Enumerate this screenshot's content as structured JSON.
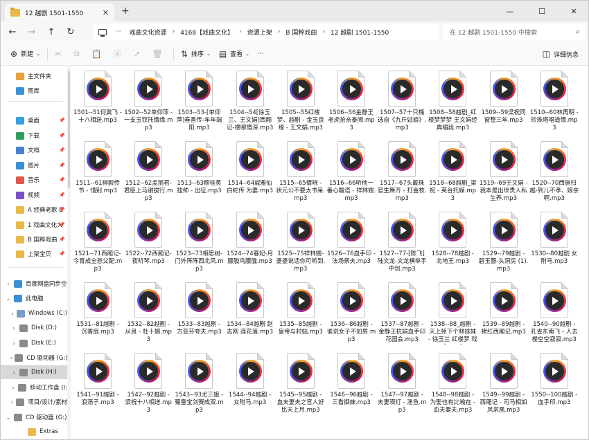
{
  "window": {
    "tab_title": "12 越剧 1501-1550",
    "tab_close": "✕",
    "new_tab": "+",
    "minimize": "—",
    "maximize": "☐",
    "close": "✕"
  },
  "nav": {
    "back": "←",
    "forward": "→",
    "up": "↑",
    "refresh": "↻",
    "more": "···",
    "breadcrumb": [
      "戏曲文化资源",
      "4168【戏曲文化】",
      "资源上架",
      "B 国粹戏曲",
      "12 越剧 1501-1550"
    ],
    "separator": "›",
    "search_placeholder": "在 12 越剧 1501-1550 中搜索",
    "search_icon": "⌕"
  },
  "commands": {
    "new": "新建",
    "new_icon": "⊕",
    "cut_icon": "✂",
    "copy_icon": "⧉",
    "paste_icon": "📋",
    "rename_icon": "Ⓐ",
    "share_icon": "↗",
    "delete_icon": "🗑",
    "sort": "排序",
    "sort_icon": "⇅",
    "view": "查看",
    "view_icon": "▤",
    "more": "···",
    "details": "详细信息",
    "details_icon": "◫"
  },
  "sidebar": {
    "items": [
      {
        "label": "主文件夹",
        "icon": "home-icon",
        "color": "#e9a23b"
      },
      {
        "label": "图库",
        "icon": "gallery-icon",
        "color": "#3a8fd6"
      },
      {
        "label": "桌面",
        "icon": "desktop-icon",
        "color": "#3a9ee0",
        "pin": "📌"
      },
      {
        "label": "下载",
        "icon": "download-icon",
        "color": "#2f9e5a",
        "pin": "📌"
      },
      {
        "label": "文档",
        "icon": "document-icon",
        "color": "#4a7fd4",
        "pin": "📌"
      },
      {
        "label": "图片",
        "icon": "pictures-icon",
        "color": "#3a8fd6",
        "pin": "📌"
      },
      {
        "label": "音乐",
        "icon": "music-icon",
        "color": "#e0584c",
        "pin": "📌"
      },
      {
        "label": "视频",
        "icon": "video-icon",
        "color": "#7b4fc9",
        "pin": "📌"
      },
      {
        "label": "A 经典老歌 E",
        "icon": "folder-icon",
        "color": "#e9b949",
        "pin": "📌"
      },
      {
        "label": "1 戏曲文化大",
        "icon": "folder-icon",
        "color": "#e9b949",
        "pin": "📌"
      },
      {
        "label": "B 国粹戏曲",
        "icon": "folder-icon",
        "color": "#e9b949",
        "pin": "📌"
      },
      {
        "label": "上架宝贝",
        "icon": "folder-icon",
        "color": "#e9b949",
        "pin": "📌"
      },
      {
        "label": "百度网盘同步空",
        "icon": "cloud-icon",
        "color": "#3a8fd6",
        "chev": "›"
      },
      {
        "label": "此电脑",
        "icon": "pc-icon",
        "color": "#3a8fd6",
        "chev": "⌄"
      },
      {
        "label": "Windows (C:)",
        "icon": "drive-icon",
        "color": "#7a9cc6",
        "chev": "›"
      },
      {
        "label": "Disk (D:)",
        "icon": "drive-icon",
        "color": "#8a8a8a",
        "chev": "›"
      },
      {
        "label": "Disk (E:)",
        "icon": "drive-icon",
        "color": "#8a8a8a",
        "chev": "›"
      },
      {
        "label": "CD 驱动器 (G:)",
        "icon": "cd-icon",
        "color": "#8a8a8a",
        "chev": "›"
      },
      {
        "label": "Disk (H:)",
        "icon": "drive-icon",
        "color": "#8a8a8a",
        "chev": "›",
        "selected": true
      },
      {
        "label": "移动工作盘 (I:",
        "icon": "drive-icon",
        "color": "#8a8a8a",
        "chev": "›"
      },
      {
        "label": "项目/设计/素材",
        "icon": "drive-icon",
        "color": "#8a8a8a",
        "chev": "›"
      },
      {
        "label": "CD 驱动器 (G:)",
        "icon": "cd-icon",
        "color": "#8a8a8a",
        "chev": "⌄"
      },
      {
        "label": "Extras",
        "icon": "folder-icon",
        "color": "#e9b949",
        "chev": ""
      }
    ]
  },
  "files": [
    [
      "1501--51何冀飞 - 十八相送.mp3",
      "1502--52单仰萍 - 一支玉钗托情缘.mp3",
      "1503--53-[单仰萍]春香传-年年端阳.mp3",
      "1504--54[徐玉兰、王文娟]西厢记-楼哪情深.mp3",
      "1505--55红楼梦、越剧 - 金玉良缘 - 王文娟.mp3",
      "1506--56金静王老虎抢亲泰闹.mp3",
      "1507--57十只桶选自《九斤姑娘》.mp3",
      "1508--58越剧_红楼梦梦梦 王文娟经典唱段.mp3",
      "1509--59梁祝同窗整三年.mp3",
      "1510--60林再明 - 珍珠塔唱道情.mp3"
    ],
    [
      "1511--61柳毅传书 - 惜别.mp3",
      "1512--62孟丽君-君臣上马谢拔行.mp3",
      "1513--63穆桂英挂帅 - 出征.mp3",
      "1514--64戚雅仙白蛇传 为妻.mp3",
      "1515--65倩晓 - 状元公不要太书呆.mp3",
      "1516--66听他一番心酸语 - 祥林嫂.mp3",
      "1517--67头戴珠官生舞齐 - 打金枝.mp3",
      "1518--68越剧_梁祝 - 英台托媒.mp3",
      "1519--69王文娟 - 我本是出世贵人私生养.mp3",
      "1520--70西施归越-到儿不孝、娘亲啊.mp3"
    ],
    [
      "1521--71西厢记-今育成全悲父配.mp3",
      "1522--72西厢记-夜听琴.mp3",
      "1523--73相思树-门外阵阵西北风.mp3",
      "1524--74春妃-月朦胧鸟朦胧.mp3",
      "1525--75祥林嫂-婆婆说话你可听到.mp3",
      "1526--76血手印 - 法场祭夫.mp3",
      "1527--77-[陈飞]陆文龙-文龙横举手中剑.mp3",
      "1528--78越剧 - 北地王.mp3",
      "1529--79越剧 - 碧玉簪-头洞房 (1).mp3",
      "1530--80越剧 女附马.mp3"
    ],
    [
      "1531--81越剧 - 沉香扇.mp3",
      "1532--82越剧 - 从良 - 杜十娘.mp3",
      "1533--83越剧 - 方亚芬夸夫.mp3",
      "1534--84越剧 赵志刚 莲花落.mp3",
      "1535--85越剧 - 皇帝与村姑.mp3",
      "1536--86越剧 - 谁说女子不如男.mp3",
      "1537--87越剧 - 金静王杭娟血手印花园会.mp3",
      "1538--88_越剧 - 天上掉下个林妹妹 - 徐玉兰 红楼梦 戏曲.mp3",
      "1539--89越剧 - 拷红西厢记.mp3",
      "1540--90越剧 - 孔雀东南飞 - 人去楼空空寂寂.mp3"
    ],
    [
      "1541--91越剧 - 浪荡子.mp3",
      "1542--92越剧 - 梁祝十八相送.mp3",
      "1543--93尤三姐 - 蜀蚕宝剑赛成双.mp3",
      "1544--94越剧 - 女附马.mp3",
      "1545--95越剧 - 血夫妻夫之官人好比天上月.mp3",
      "1546--96越剧 - 三看御妹.mp3",
      "1547--97越剧 - 夫妻观灯 - 渔鱼.mp3",
      "1548--98越剧 - 为娶也有比喻在 - 血夫妻夫.mp3",
      "1549--99越剧 - 西厢记 - 司马相如 凤求凰.mp3",
      "1550--100越剧 - 血手印.mp3"
    ]
  ]
}
